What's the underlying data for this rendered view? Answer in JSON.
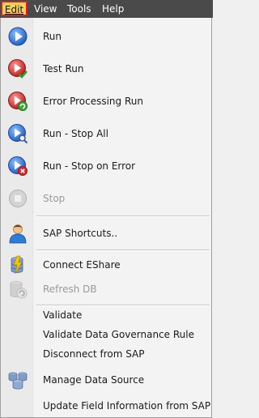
{
  "menubar": {
    "edit": "Edit",
    "view": "View",
    "tools": "Tools",
    "help": "Help"
  },
  "menu": {
    "run": "Run",
    "test_run": "Test Run",
    "error_processing_run": "Error Processing Run",
    "run_stop_all": "Run - Stop All",
    "run_stop_on_error": "Run - Stop on Error",
    "stop": "Stop",
    "sap_shortcuts": "SAP Shortcuts..",
    "connect_eshare": "Connect EShare",
    "refresh_db": "Refresh DB",
    "validate": "Validate",
    "validate_dgr": "Validate Data Governance Rule",
    "disconnect_sap": "Disconnect from SAP",
    "manage_data_source": "Manage Data Source",
    "update_field_info": "Update Field Information from SAP"
  },
  "colors": {
    "menubar_bg": "#4a4a4a",
    "active_menu_bg": "#f3d160",
    "active_menu_border": "#e11b1b",
    "run_blue": "#2f6fd8",
    "test_red": "#d43c3c"
  }
}
